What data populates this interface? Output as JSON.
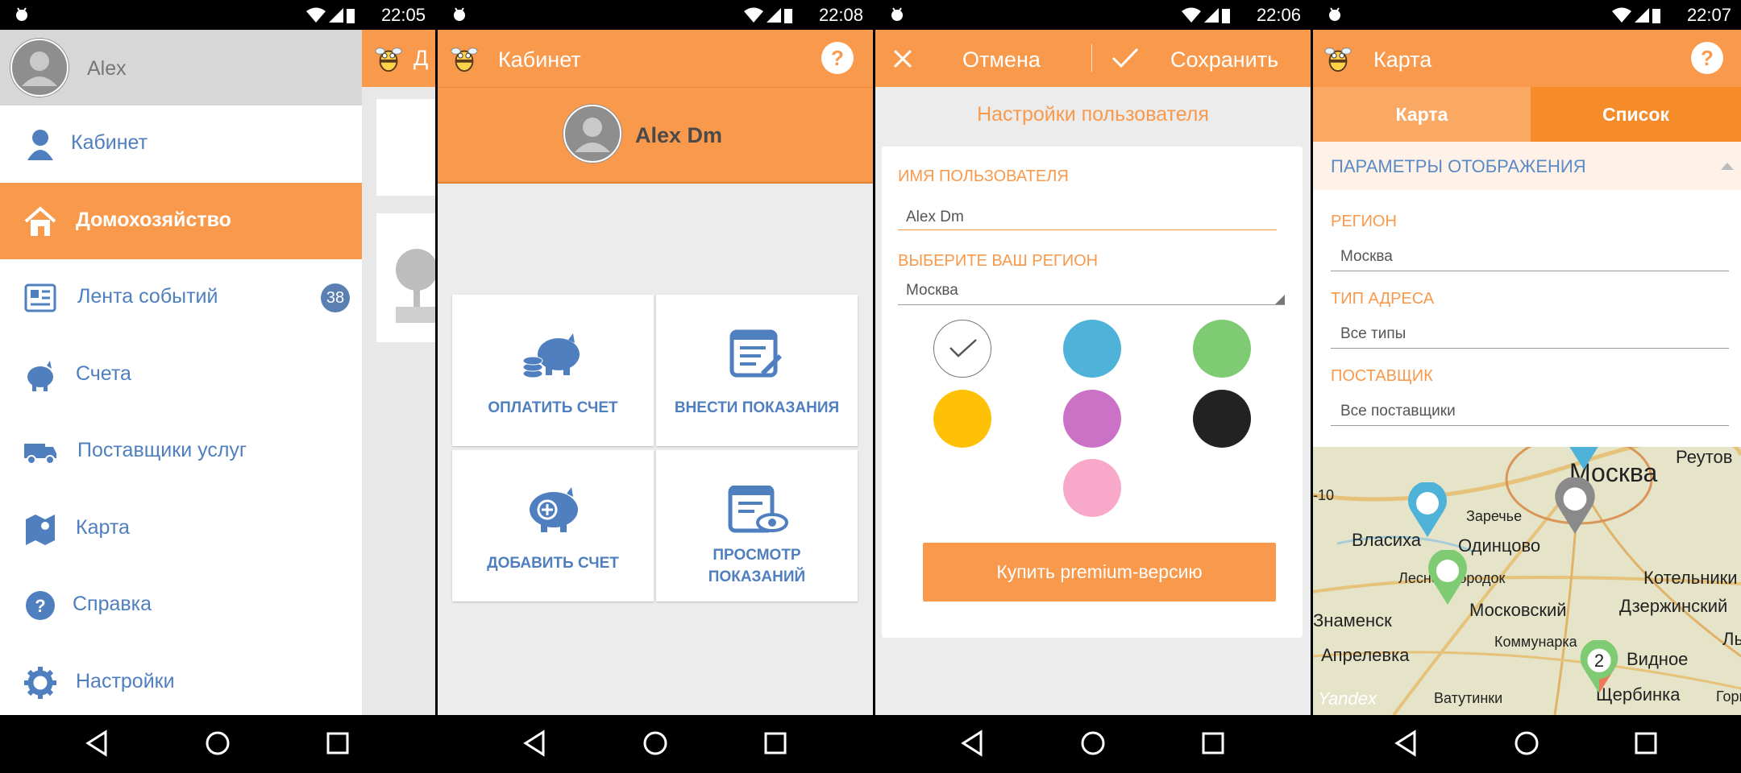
{
  "screens": {
    "s1": {
      "time": "22:05",
      "user_name": "Alex",
      "behind_title": "Д",
      "menu": [
        {
          "label": "Кабинет",
          "icon": "person-icon"
        },
        {
          "label": "Домохозяйство",
          "icon": "house-icon",
          "active": true
        },
        {
          "label": "Лента событий",
          "icon": "newspaper-icon",
          "badge": "38"
        },
        {
          "label": "Счета",
          "icon": "piggy-bank-icon"
        },
        {
          "label": "Поставщики услуг",
          "icon": "truck-icon"
        },
        {
          "label": "Карта",
          "icon": "map-icon"
        },
        {
          "label": "Справка",
          "icon": "help-icon"
        },
        {
          "label": "Настройки",
          "icon": "gear-icon"
        }
      ]
    },
    "s2": {
      "time": "22:08",
      "title": "Кабинет",
      "user_name": "Alex Dm",
      "tiles": [
        {
          "label": "ОПЛАТИТЬ СЧЕТ",
          "icon": "piggy-coins-icon"
        },
        {
          "label": "ВНЕСТИ ПОКАЗАНИЯ",
          "icon": "document-edit-icon"
        },
        {
          "label": "ДОБАВИТЬ СЧЕТ",
          "icon": "piggy-add-icon"
        },
        {
          "label": "ПРОСМОТР ПОКАЗАНИЙ",
          "icon": "document-view-icon"
        }
      ]
    },
    "s3": {
      "time": "22:06",
      "cancel": "Отмена",
      "save": "Сохранить",
      "heading": "Настройки пользователя",
      "username_label": "ИМЯ ПОЛЬЗОВАТЕЛЯ",
      "username_value": "Alex Dm",
      "region_label": "ВЫБЕРИТЕ ВАШ РЕГИОН",
      "region_value": "Москва",
      "colors": [
        "#ffffff",
        "#4fb3d9",
        "#7fcb73",
        "#ffc107",
        "#cc72c6",
        "#222222",
        "#f8a8c8"
      ],
      "buy_button": "Купить premium-версию"
    },
    "s4": {
      "time": "22:07",
      "title": "Карта",
      "tab_map": "Карта",
      "tab_list": "Список",
      "section": "ПАРАМЕТРЫ ОТОБРАЖЕНИЯ",
      "region_label": "РЕГИОН",
      "region_value": "Москва",
      "address_label": "ТИП АДРЕСА",
      "address_value": "Все типы",
      "provider_label": "ПОСТАВЩИК",
      "provider_value": "Все поставщики",
      "map_labels": [
        "Реутов",
        "Москва",
        "Власиха",
        "Заречье",
        "Одинцово",
        "Лесной Городок",
        "Котельники",
        "Московский",
        "Дзержинский",
        "Знаменск",
        "Коммунарка",
        "Апрелевка",
        "Видное",
        "Ватутинки",
        "Щербинка",
        "Yandex",
        "-10",
        "Лы",
        "Горк"
      ],
      "cluster": "2"
    }
  },
  "colors": {
    "accent": "#f8994c",
    "blue": "#4f7fbf"
  }
}
